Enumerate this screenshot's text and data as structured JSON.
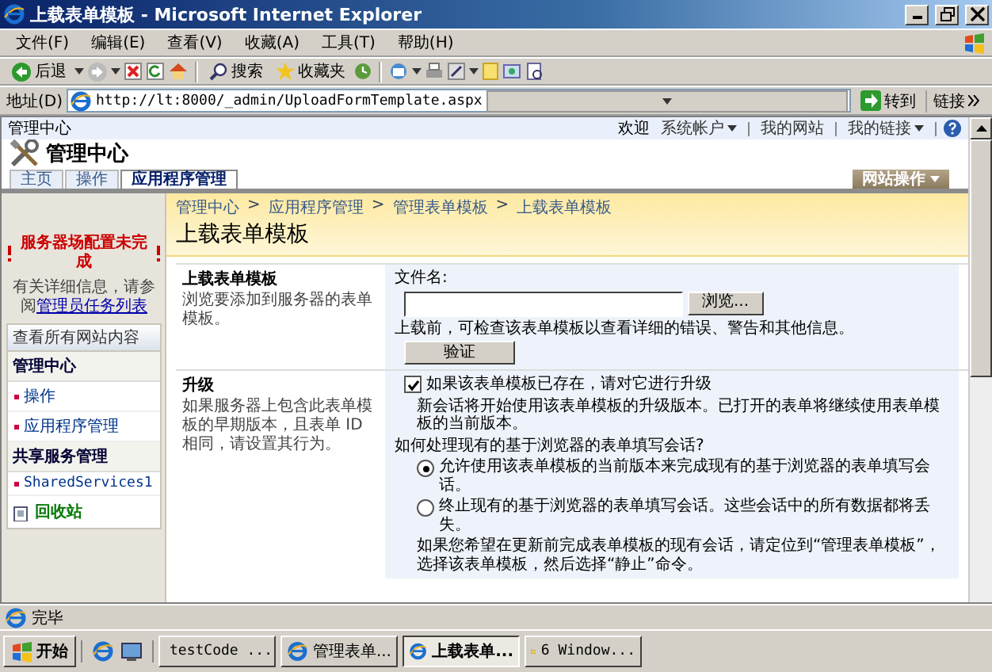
{
  "window": {
    "title": "上载表单模板 - Microsoft Internet Explorer"
  },
  "menu": [
    "文件(F)",
    "编辑(E)",
    "查看(V)",
    "收藏(A)",
    "工具(T)",
    "帮助(H)"
  ],
  "toolbar": {
    "back": "后退",
    "search": "搜索",
    "favorites": "收藏夹"
  },
  "address": {
    "label": "地址(D)",
    "value": "http://lt:8000/_admin/UploadFormTemplate.aspx",
    "go": "转到",
    "links": "链接"
  },
  "site": {
    "top_left": "管理中心",
    "welcome": "欢迎",
    "user": "系统帐户",
    "my_site": "我的网站",
    "my_links": "我的链接",
    "title": "管理中心",
    "site_actions": "网站操作",
    "tabs": [
      {
        "label": "主页",
        "selected": false
      },
      {
        "label": "操作",
        "selected": false
      },
      {
        "label": "应用程序管理",
        "selected": true
      }
    ]
  },
  "sidebar": {
    "warning": "服务器场配置未完成",
    "info": "有关详细信息，请参阅",
    "info_link": "管理员任务列表",
    "view_all": "查看所有网站内容",
    "sections": [
      {
        "heading": "管理中心",
        "items": [
          "操作",
          "应用程序管理"
        ]
      },
      {
        "heading": "共享服务管理",
        "items": [
          "SharedServices1"
        ]
      }
    ],
    "recycle": "回收站"
  },
  "breadcrumb": {
    "separator": ">",
    "items": [
      "管理中心",
      "应用程序管理",
      "管理表单模板",
      "上载表单模板"
    ]
  },
  "page_title": "上载表单模板",
  "upload": {
    "title": "上载表单模板",
    "description": "浏览要添加到服务器的表单模板。",
    "file_label": "文件名:",
    "browse": "浏览...",
    "hint": "上载前，可检查该表单模板以查看详细的错误、警告和其他信息。",
    "verify": "验证"
  },
  "upgrade": {
    "title": "升级",
    "description": "如果服务器上包含此表单模板的早期版本，且表单 ID 相同，请设置其行为。",
    "checkbox": {
      "label": "如果该表单模板已存在，请对它进行升级",
      "checked": true
    },
    "note": "新会话将开始使用该表单模板的升级版本。已打开的表单将继续使用表单模板的当前版本。",
    "question": "如何处理现有的基于浏览器的表单填写会话?",
    "options": [
      {
        "label": "允许使用该表单模板的当前版本来完成现有的基于浏览器的表单填写会话。",
        "selected": true
      },
      {
        "label": "终止现有的基于浏览器的表单填写会话。这些会话中的所有数据都将丢失。",
        "selected": false
      }
    ],
    "footer": "如果您希望在更新前完成表单模板的现有会话，请定位到“管理表单模板”，选择该表单模板，然后选择“静止”命令。"
  },
  "status_bar": {
    "text": "完毕"
  },
  "taskbar": {
    "start": "开始",
    "tasks": [
      {
        "label": "testCode ...",
        "kind": "ie",
        "selected": false
      },
      {
        "label": "管理表单...",
        "kind": "ie",
        "selected": false
      },
      {
        "label": "上载表单...",
        "kind": "ie",
        "selected": true
      },
      {
        "label": "6 Window...",
        "kind": "folder",
        "selected": false
      }
    ]
  }
}
